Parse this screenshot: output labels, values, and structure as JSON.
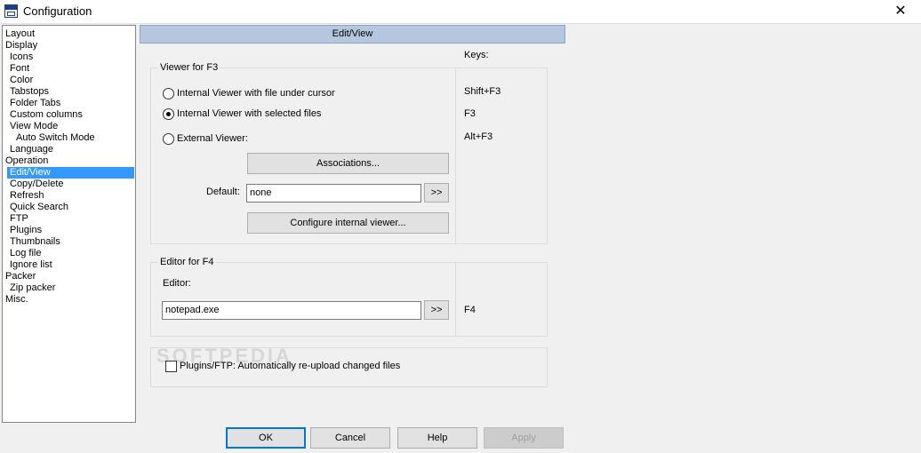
{
  "window": {
    "title": "Configuration",
    "close_glyph": "✕"
  },
  "tree": [
    {
      "label": "Layout",
      "level": 1
    },
    {
      "label": "Display",
      "level": 1
    },
    {
      "label": "Icons",
      "level": 2
    },
    {
      "label": "Font",
      "level": 2
    },
    {
      "label": "Color",
      "level": 2
    },
    {
      "label": "Tabstops",
      "level": 2
    },
    {
      "label": "Folder Tabs",
      "level": 2
    },
    {
      "label": "Custom columns",
      "level": 2
    },
    {
      "label": "View Mode",
      "level": 2
    },
    {
      "label": "Auto Switch Mode",
      "level": 3
    },
    {
      "label": "Language",
      "level": 2
    },
    {
      "label": "Operation",
      "level": 1
    },
    {
      "label": "Edit/View",
      "level": 2,
      "selected": true
    },
    {
      "label": "Copy/Delete",
      "level": 2
    },
    {
      "label": "Refresh",
      "level": 2
    },
    {
      "label": "Quick Search",
      "level": 2
    },
    {
      "label": "FTP",
      "level": 2
    },
    {
      "label": "Plugins",
      "level": 2
    },
    {
      "label": "Thumbnails",
      "level": 2
    },
    {
      "label": "Log file",
      "level": 2
    },
    {
      "label": "Ignore list",
      "level": 2
    },
    {
      "label": "Packer",
      "level": 1
    },
    {
      "label": "Zip packer",
      "level": 2
    },
    {
      "label": "Misc.",
      "level": 1
    }
  ],
  "page": {
    "header": "Edit/View",
    "keys_label": "Keys:"
  },
  "viewer": {
    "legend": "Viewer for F3",
    "options": [
      {
        "label": "Internal Viewer with file under cursor",
        "key": "Shift+F3",
        "checked": false
      },
      {
        "label": "Internal Viewer with selected files",
        "key": "F3",
        "checked": true
      },
      {
        "label": "External Viewer:",
        "key": "Alt+F3",
        "checked": false
      }
    ],
    "associations_button": "Associations...",
    "default_label": "Default:",
    "default_value": "none",
    "browse_button": ">>",
    "configure_button": "Configure internal viewer..."
  },
  "editor": {
    "legend": "Editor for F4",
    "editor_label": "Editor:",
    "editor_value": "notepad.exe",
    "browse_button": ">>",
    "key": "F4"
  },
  "plugins": {
    "reupload_label": "Plugins/FTP: Automatically re-upload changed files",
    "checked": false
  },
  "buttons": {
    "ok": "OK",
    "cancel": "Cancel",
    "help": "Help",
    "apply": "Apply"
  },
  "watermark": "SOFTPEDIA",
  "colors": {
    "header_bar": "#b5c7de",
    "selection": "#3399ff",
    "default_button_border": "#0078d7"
  }
}
